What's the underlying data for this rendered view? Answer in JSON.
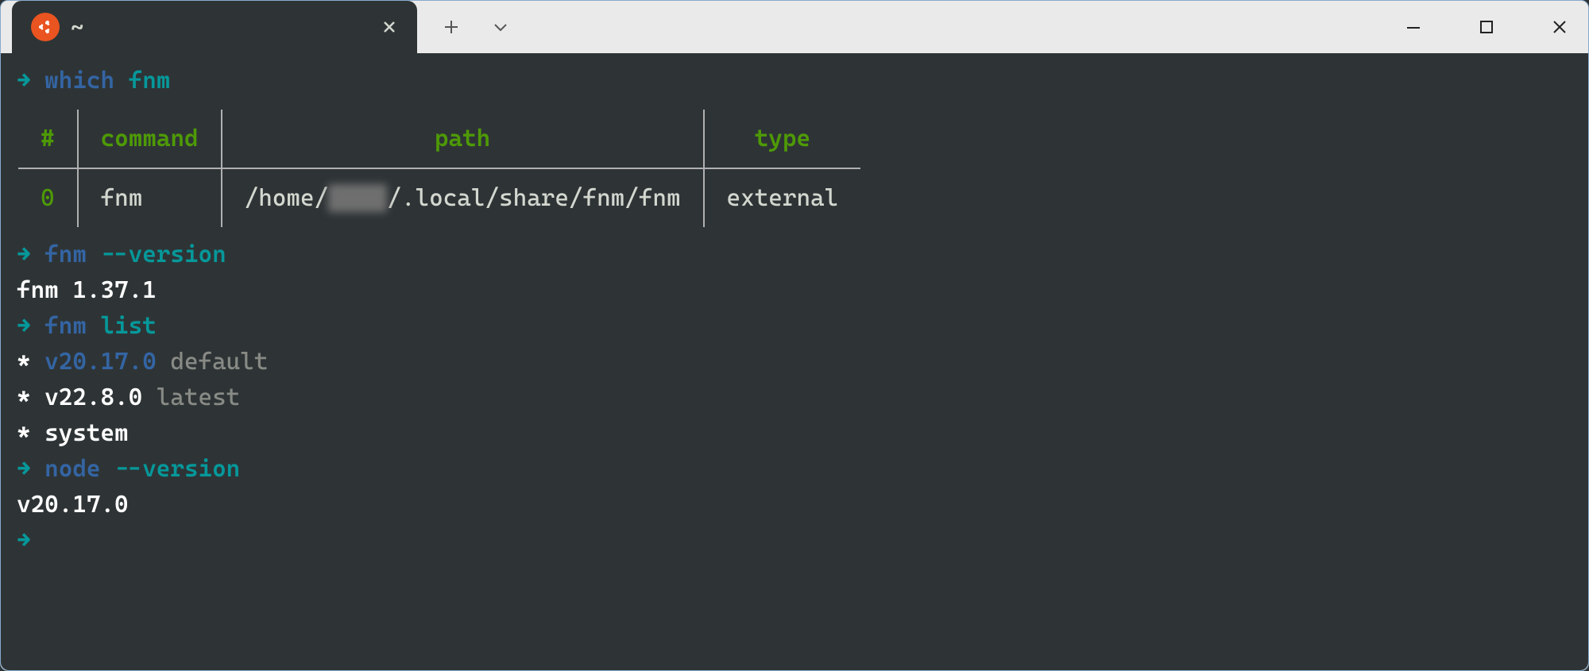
{
  "tab": {
    "title": "~"
  },
  "prompts": {
    "arrow": "→",
    "which": {
      "cmd": "which",
      "arg": "fnm"
    },
    "fnm_version": {
      "cmd": "fnm",
      "arg": "--version"
    },
    "fnm_list": {
      "cmd": "fnm",
      "arg": "list"
    },
    "node_version": {
      "cmd": "node",
      "arg": "--version"
    }
  },
  "which_table": {
    "headers": {
      "idx": "#",
      "command": "command",
      "path": "path",
      "type": "type"
    },
    "row": {
      "idx": "0",
      "command": "fnm",
      "path_pre": "/home/",
      "path_blur": "████",
      "path_post": "/.local/share/fnm/fnm",
      "type": "external"
    }
  },
  "outputs": {
    "fnm_version": "fnm 1.37.1",
    "fnm_list": [
      {
        "bullet": "*",
        "version": "v20.17.0",
        "alias": "default"
      },
      {
        "bullet": "*",
        "version": "v22.8.0",
        "alias": "latest"
      },
      {
        "bullet": "*",
        "version": "system",
        "alias": ""
      }
    ],
    "node_version": "v20.17.0"
  }
}
